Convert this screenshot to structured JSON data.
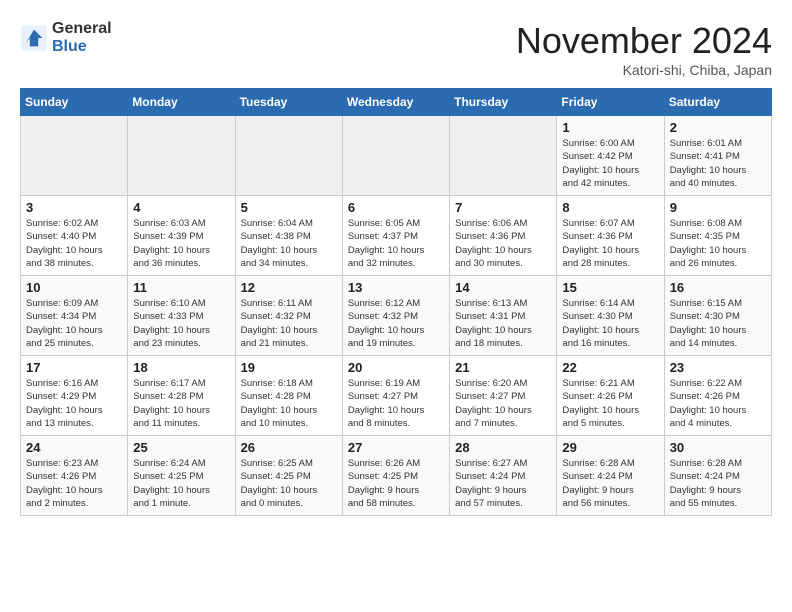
{
  "header": {
    "logo_general": "General",
    "logo_blue": "Blue",
    "month_title": "November 2024",
    "location": "Katori-shi, Chiba, Japan"
  },
  "weekdays": [
    "Sunday",
    "Monday",
    "Tuesday",
    "Wednesday",
    "Thursday",
    "Friday",
    "Saturday"
  ],
  "weeks": [
    [
      {
        "day": "",
        "info": ""
      },
      {
        "day": "",
        "info": ""
      },
      {
        "day": "",
        "info": ""
      },
      {
        "day": "",
        "info": ""
      },
      {
        "day": "",
        "info": ""
      },
      {
        "day": "1",
        "info": "Sunrise: 6:00 AM\nSunset: 4:42 PM\nDaylight: 10 hours\nand 42 minutes."
      },
      {
        "day": "2",
        "info": "Sunrise: 6:01 AM\nSunset: 4:41 PM\nDaylight: 10 hours\nand 40 minutes."
      }
    ],
    [
      {
        "day": "3",
        "info": "Sunrise: 6:02 AM\nSunset: 4:40 PM\nDaylight: 10 hours\nand 38 minutes."
      },
      {
        "day": "4",
        "info": "Sunrise: 6:03 AM\nSunset: 4:39 PM\nDaylight: 10 hours\nand 36 minutes."
      },
      {
        "day": "5",
        "info": "Sunrise: 6:04 AM\nSunset: 4:38 PM\nDaylight: 10 hours\nand 34 minutes."
      },
      {
        "day": "6",
        "info": "Sunrise: 6:05 AM\nSunset: 4:37 PM\nDaylight: 10 hours\nand 32 minutes."
      },
      {
        "day": "7",
        "info": "Sunrise: 6:06 AM\nSunset: 4:36 PM\nDaylight: 10 hours\nand 30 minutes."
      },
      {
        "day": "8",
        "info": "Sunrise: 6:07 AM\nSunset: 4:36 PM\nDaylight: 10 hours\nand 28 minutes."
      },
      {
        "day": "9",
        "info": "Sunrise: 6:08 AM\nSunset: 4:35 PM\nDaylight: 10 hours\nand 26 minutes."
      }
    ],
    [
      {
        "day": "10",
        "info": "Sunrise: 6:09 AM\nSunset: 4:34 PM\nDaylight: 10 hours\nand 25 minutes."
      },
      {
        "day": "11",
        "info": "Sunrise: 6:10 AM\nSunset: 4:33 PM\nDaylight: 10 hours\nand 23 minutes."
      },
      {
        "day": "12",
        "info": "Sunrise: 6:11 AM\nSunset: 4:32 PM\nDaylight: 10 hours\nand 21 minutes."
      },
      {
        "day": "13",
        "info": "Sunrise: 6:12 AM\nSunset: 4:32 PM\nDaylight: 10 hours\nand 19 minutes."
      },
      {
        "day": "14",
        "info": "Sunrise: 6:13 AM\nSunset: 4:31 PM\nDaylight: 10 hours\nand 18 minutes."
      },
      {
        "day": "15",
        "info": "Sunrise: 6:14 AM\nSunset: 4:30 PM\nDaylight: 10 hours\nand 16 minutes."
      },
      {
        "day": "16",
        "info": "Sunrise: 6:15 AM\nSunset: 4:30 PM\nDaylight: 10 hours\nand 14 minutes."
      }
    ],
    [
      {
        "day": "17",
        "info": "Sunrise: 6:16 AM\nSunset: 4:29 PM\nDaylight: 10 hours\nand 13 minutes."
      },
      {
        "day": "18",
        "info": "Sunrise: 6:17 AM\nSunset: 4:28 PM\nDaylight: 10 hours\nand 11 minutes."
      },
      {
        "day": "19",
        "info": "Sunrise: 6:18 AM\nSunset: 4:28 PM\nDaylight: 10 hours\nand 10 minutes."
      },
      {
        "day": "20",
        "info": "Sunrise: 6:19 AM\nSunset: 4:27 PM\nDaylight: 10 hours\nand 8 minutes."
      },
      {
        "day": "21",
        "info": "Sunrise: 6:20 AM\nSunset: 4:27 PM\nDaylight: 10 hours\nand 7 minutes."
      },
      {
        "day": "22",
        "info": "Sunrise: 6:21 AM\nSunset: 4:26 PM\nDaylight: 10 hours\nand 5 minutes."
      },
      {
        "day": "23",
        "info": "Sunrise: 6:22 AM\nSunset: 4:26 PM\nDaylight: 10 hours\nand 4 minutes."
      }
    ],
    [
      {
        "day": "24",
        "info": "Sunrise: 6:23 AM\nSunset: 4:26 PM\nDaylight: 10 hours\nand 2 minutes."
      },
      {
        "day": "25",
        "info": "Sunrise: 6:24 AM\nSunset: 4:25 PM\nDaylight: 10 hours\nand 1 minute."
      },
      {
        "day": "26",
        "info": "Sunrise: 6:25 AM\nSunset: 4:25 PM\nDaylight: 10 hours\nand 0 minutes."
      },
      {
        "day": "27",
        "info": "Sunrise: 6:26 AM\nSunset: 4:25 PM\nDaylight: 9 hours\nand 58 minutes."
      },
      {
        "day": "28",
        "info": "Sunrise: 6:27 AM\nSunset: 4:24 PM\nDaylight: 9 hours\nand 57 minutes."
      },
      {
        "day": "29",
        "info": "Sunrise: 6:28 AM\nSunset: 4:24 PM\nDaylight: 9 hours\nand 56 minutes."
      },
      {
        "day": "30",
        "info": "Sunrise: 6:28 AM\nSunset: 4:24 PM\nDaylight: 9 hours\nand 55 minutes."
      }
    ]
  ]
}
